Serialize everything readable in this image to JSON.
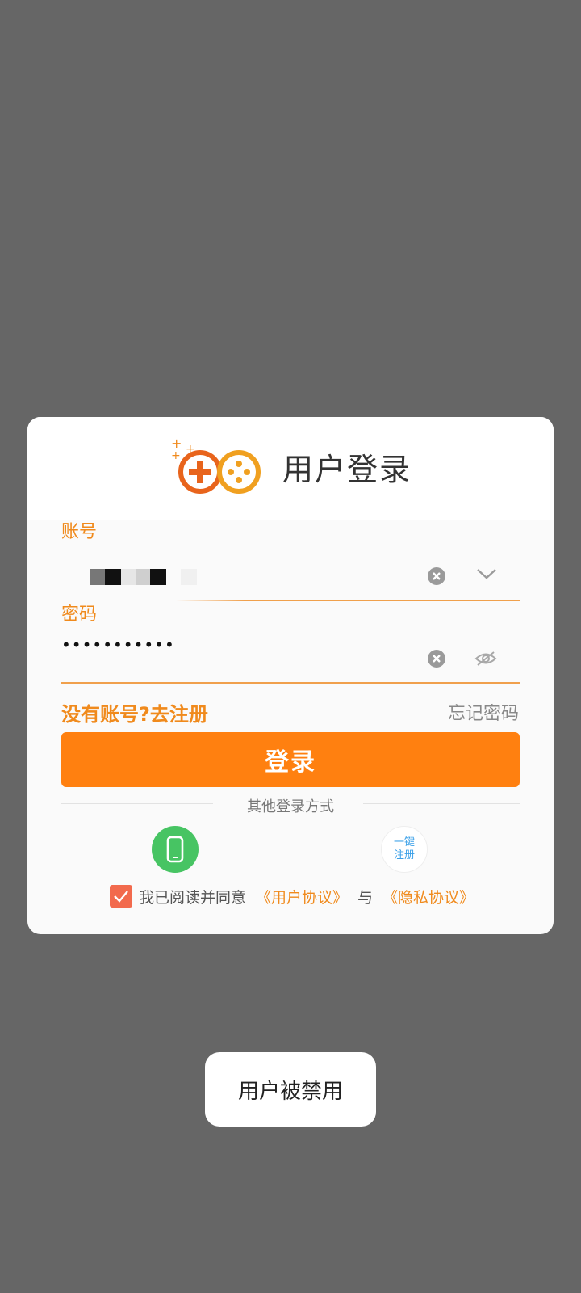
{
  "dialog": {
    "title": "用户登录",
    "logo_icon": "gamepad-logo-icon"
  },
  "account": {
    "label": "账号",
    "value": "",
    "clear_icon": "clear-icon",
    "dropdown_icon": "chevron-down-icon"
  },
  "password": {
    "label": "密码",
    "value": "•••••••••••",
    "clear_icon": "clear-icon",
    "visibility_icon": "eye-hidden-icon"
  },
  "links": {
    "register": "没有账号?去注册",
    "forgot": "忘记密码"
  },
  "login_button": "登录",
  "other_login": {
    "label": "其他登录方式",
    "phone_icon": "phone-icon",
    "onekey_line1": "一键",
    "onekey_line2": "注册"
  },
  "agreement": {
    "checked": true,
    "text": "我已阅读并同意",
    "user_agreement": "《用户协议》",
    "and": "与",
    "privacy_agreement": "《隐私协议》"
  },
  "toast": "用户被禁用",
  "colors": {
    "accent": "#ff8010",
    "label_orange": "#f08a1c",
    "phone_green": "#47c463",
    "checkbox": "#f26a4d",
    "backdrop": "#666666"
  }
}
